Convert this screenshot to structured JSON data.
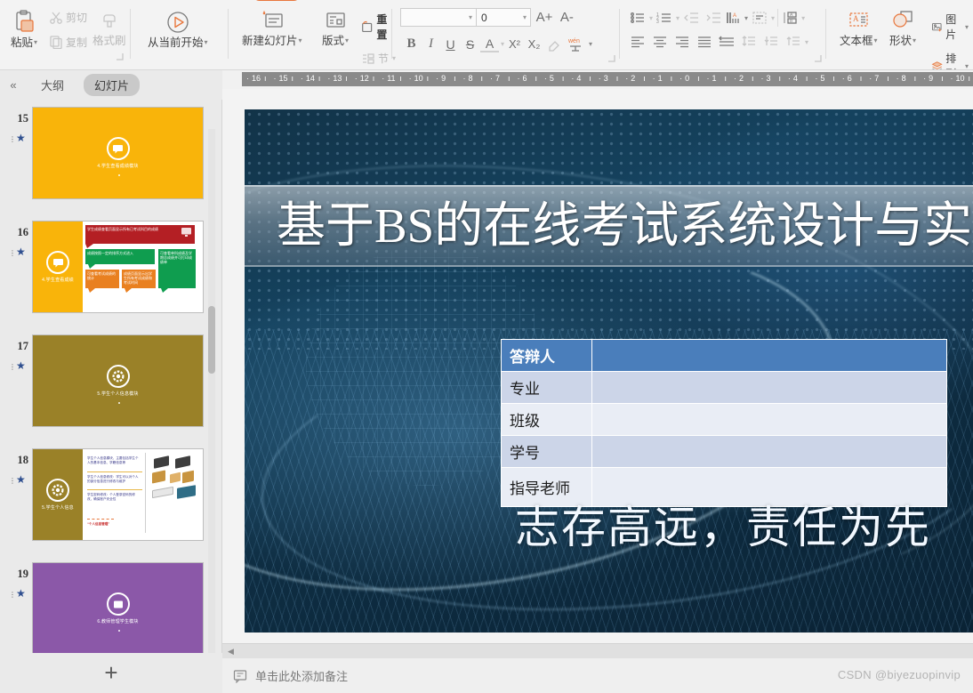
{
  "app": {
    "watermark": "CSDN @biyezuopinvip"
  },
  "ribbon": {
    "groups": {
      "clipboard": {
        "paste": "粘贴",
        "cut": "剪切",
        "copy": "复制",
        "format_painter": "格式刷"
      },
      "slideshow": {
        "from_current": "从当前开始"
      },
      "slides": {
        "new_slide": "新建幻灯片",
        "layout": "版式",
        "section": "节",
        "reset": "重置"
      },
      "font": {
        "font_name_value": "",
        "font_name_placeholder": "",
        "font_size_value": "0",
        "grow_font": "A+",
        "shrink_font": "A-",
        "bold": "B",
        "italic": "I",
        "underline": "U",
        "strikethrough": "S",
        "font_color": "A",
        "superscript": "X²",
        "subscript": "X₂",
        "clear_format": "清除格式",
        "pinyin": "wén"
      },
      "paragraph": {
        "bullets": "项目符号",
        "numbering": "编号",
        "decrease_indent": "减少缩进量",
        "increase_indent": "增加缩进量",
        "text_direction": "文字方向",
        "align_text": "对齐文本",
        "convert_smartart": "转换为SmartArt",
        "align_left": "左对齐",
        "align_center": "居中",
        "align_right": "右对齐",
        "justify": "两端对齐",
        "distribute": "分散对齐",
        "line_spacing_1": "行距",
        "line_spacing_2": "段前距",
        "line_spacing_3": "段落间距"
      },
      "insert": {
        "textbox": "文本框",
        "shape": "形状",
        "picture": "图片",
        "arrange": "排列"
      }
    }
  },
  "left_panel": {
    "collapse_label": "«",
    "tabs": [
      {
        "label": "大纲",
        "active": false
      },
      {
        "label": "幻灯片",
        "active": true
      }
    ],
    "add_slide_label": "+",
    "thumbnails": [
      {
        "number": "15",
        "title": "4.学生查看成绩模块",
        "bg": "#f9b40a",
        "kind": "cover-chat",
        "selected": false
      },
      {
        "number": "16",
        "title": "4.学生查看成绩",
        "bg": "#f9b40a",
        "kind": "content-cards",
        "selected": false,
        "cards": [
          {
            "text": "学生成绩查看页面显示所有已考试科目的成绩",
            "color": "#b41f24"
          },
          {
            "text": "成绩按照一定的排序方式进入",
            "color": "#0f9d4f"
          },
          {
            "text": "可查看单科成绩及学期总成绩并可打印成绩单",
            "color": "#0f9d4f"
          },
          {
            "text": "可查看考试成绩的统计",
            "color": "#e98020"
          },
          {
            "text": "成绩页面显示出学生所有考试成绩和考试时间",
            "color": "#e98020"
          }
        ]
      },
      {
        "number": "17",
        "title": "5.学生个人信息模块",
        "bg": "#9a8128",
        "kind": "cover-gear",
        "selected": false
      },
      {
        "number": "18",
        "title": "5.学生个人信息",
        "bg": "#9a8128",
        "kind": "content-list",
        "selected": false,
        "bullets": [
          "学生个人信息模块，主要包括学生个人的基本信息、学籍信息等",
          "学生个人信息修改：学生可以对个人的部分信息进行修改与维护",
          "学生密码修改：个人登录密码的修改，确保账户安全性"
        ],
        "footnote": "“个人信息管理”"
      },
      {
        "number": "19",
        "title": "6.教师管理学生模块",
        "bg": "#8b58a8",
        "kind": "cover-doc",
        "selected": false
      }
    ]
  },
  "ruler": {
    "ticks": [
      "16",
      "15",
      "14",
      "13",
      "12",
      "11",
      "10",
      "9",
      "8",
      "7",
      "6",
      "5",
      "4",
      "3",
      "2",
      "1",
      "0",
      "1",
      "2",
      "3",
      "4",
      "5",
      "6",
      "7",
      "8",
      "9",
      "10"
    ]
  },
  "slide": {
    "title": "基于BS的在线考试系统设计与实现",
    "table": [
      {
        "label": "答辩人",
        "value": "",
        "style": "header"
      },
      {
        "label": "专业",
        "value": "",
        "style": "alt-a"
      },
      {
        "label": "班级",
        "value": "",
        "style": "alt-b"
      },
      {
        "label": "学号",
        "value": "",
        "style": "alt-a"
      },
      {
        "label": "指导老师",
        "value": "",
        "style": "alt-b-tall"
      }
    ],
    "motto": "志存高远，责任为先"
  },
  "notes": {
    "placeholder": "单击此处添加备注"
  },
  "colors": {
    "accent_orange": "#e8773d",
    "table_header_blue": "#4a7ebb",
    "slide_bg_dark": "#123348"
  }
}
